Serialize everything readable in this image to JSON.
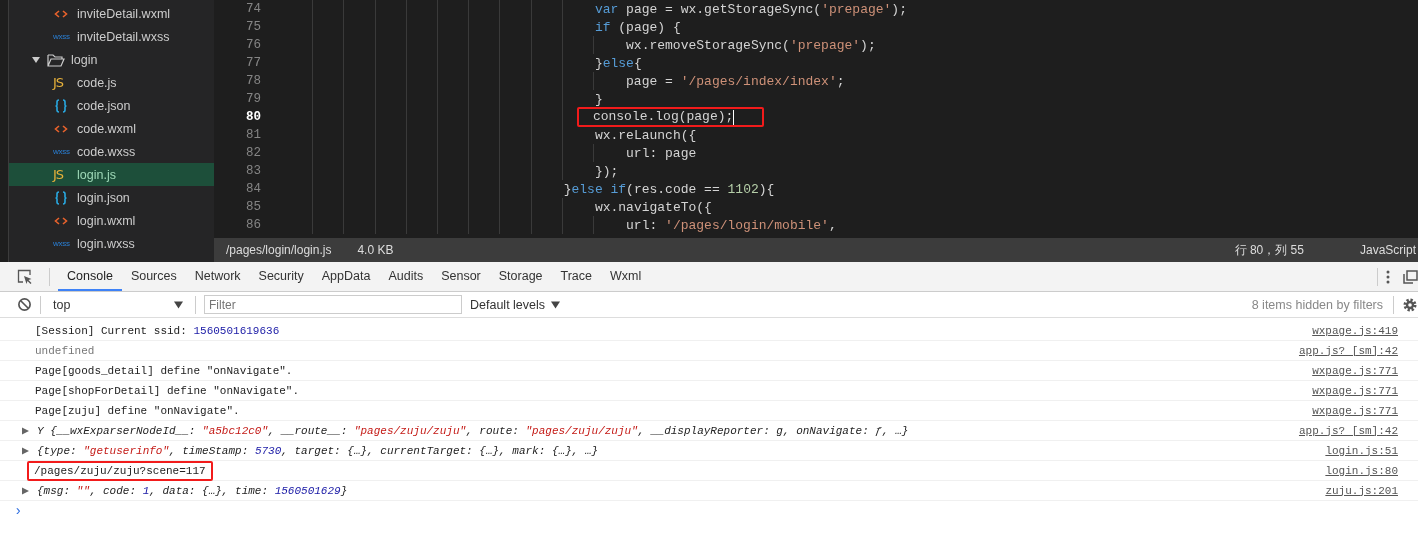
{
  "sidebar": {
    "items": [
      {
        "kind": "wxml",
        "label": "inviteDetail.wxml",
        "selected": false
      },
      {
        "kind": "wxss",
        "icon": "wxss",
        "label": "inviteDetail.wxss",
        "selected": false
      },
      {
        "kind": "folder",
        "label": "login",
        "selected": false,
        "expanded": true,
        "children": [
          {
            "kind": "js",
            "icon": "JS",
            "label": "code.js",
            "selected": false
          },
          {
            "kind": "json",
            "label": "code.json",
            "selected": false
          },
          {
            "kind": "wxml",
            "label": "code.wxml",
            "selected": false
          },
          {
            "kind": "wxss",
            "icon": "wxss",
            "label": "code.wxss",
            "selected": false
          },
          {
            "kind": "js",
            "icon": "JS",
            "label": "login.js",
            "selected": true
          },
          {
            "kind": "json",
            "label": "login.json",
            "selected": false
          },
          {
            "kind": "wxml",
            "label": "login.wxml",
            "selected": false
          },
          {
            "kind": "wxss",
            "icon": "wxss",
            "label": "login.wxss",
            "selected": false
          }
        ]
      }
    ]
  },
  "editor": {
    "lines": [
      {
        "number": "74",
        "current": false,
        "highlighted": false,
        "tokens": [
          {
            "kind": "keyword",
            "text": "                                        var"
          },
          {
            "kind": "plain",
            "text": " page = wx.getStorageSync("
          },
          {
            "kind": "string",
            "text": "'prepage'"
          },
          {
            "kind": "plain",
            "text": ");"
          }
        ]
      },
      {
        "number": "75",
        "current": false,
        "highlighted": false,
        "tokens": [
          {
            "kind": "keyword",
            "text": "                                        if"
          },
          {
            "kind": "plain",
            "text": " (page) {"
          }
        ]
      },
      {
        "number": "76",
        "current": false,
        "highlighted": false,
        "tokens": [
          {
            "kind": "plain",
            "text": "                                            wx.removeStorageSync("
          },
          {
            "kind": "string",
            "text": "'prepage'"
          },
          {
            "kind": "plain",
            "text": ");"
          }
        ]
      },
      {
        "number": "77",
        "current": false,
        "highlighted": false,
        "tokens": [
          {
            "kind": "plain",
            "text": "                                        }"
          },
          {
            "kind": "keyword",
            "text": "else"
          },
          {
            "kind": "plain",
            "text": "{"
          }
        ]
      },
      {
        "number": "78",
        "current": false,
        "highlighted": false,
        "tokens": [
          {
            "kind": "plain",
            "text": "                                            page = "
          },
          {
            "kind": "string",
            "text": "'/pages/index/index'"
          },
          {
            "kind": "plain",
            "text": ";"
          }
        ]
      },
      {
        "number": "79",
        "current": false,
        "highlighted": false,
        "tokens": [
          {
            "kind": "plain",
            "text": "                                        }"
          }
        ]
      },
      {
        "number": "80",
        "current": true,
        "highlighted": true,
        "tokens": [
          {
            "kind": "plain",
            "text": "                                        console.log(page);"
          }
        ]
      },
      {
        "number": "81",
        "current": false,
        "highlighted": false,
        "tokens": [
          {
            "kind": "plain",
            "text": "                                        wx.reLaunch({"
          }
        ]
      },
      {
        "number": "82",
        "current": false,
        "highlighted": false,
        "tokens": [
          {
            "kind": "plain",
            "text": "                                            url: page"
          }
        ]
      },
      {
        "number": "83",
        "current": false,
        "highlighted": false,
        "tokens": [
          {
            "kind": "plain",
            "text": "                                        });"
          }
        ]
      },
      {
        "number": "84",
        "current": false,
        "highlighted": false,
        "tokens": [
          {
            "kind": "plain",
            "text": "                                    }"
          },
          {
            "kind": "keyword",
            "text": "else if"
          },
          {
            "kind": "plain",
            "text": "(res.code == "
          },
          {
            "kind": "number",
            "text": "1102"
          },
          {
            "kind": "plain",
            "text": "){"
          }
        ]
      },
      {
        "number": "85",
        "current": false,
        "highlighted": false,
        "tokens": [
          {
            "kind": "plain",
            "text": "                                        wx.navigateTo({"
          }
        ]
      },
      {
        "number": "86",
        "current": false,
        "highlighted": false,
        "tokens": [
          {
            "kind": "plain",
            "text": "                                            url: "
          },
          {
            "kind": "string",
            "text": "'/pages/login/mobile'"
          },
          {
            "kind": "plain",
            "text": ","
          }
        ]
      }
    ]
  },
  "status_bar": {
    "path": "/pages/login/login.js",
    "size": "4.0 KB",
    "position": "行 80，列 55",
    "language": "JavaScript"
  },
  "devtools": {
    "tabs": [
      {
        "label": "Console",
        "selected": true
      },
      {
        "label": "Sources",
        "selected": false
      },
      {
        "label": "Network",
        "selected": false
      },
      {
        "label": "Security",
        "selected": false
      },
      {
        "label": "AppData",
        "selected": false
      },
      {
        "label": "Audits",
        "selected": false
      },
      {
        "label": "Sensor",
        "selected": false
      },
      {
        "label": "Storage",
        "selected": false
      },
      {
        "label": "Trace",
        "selected": false
      },
      {
        "label": "Wxml",
        "selected": false
      }
    ],
    "context": "top",
    "filter": {
      "placeholder": "Filter"
    },
    "levels": "Default levels",
    "hidden_count": "8 items hidden by filters",
    "messages": [
      {
        "kind": "text",
        "highlighted": false,
        "source": "wxpage.js:419",
        "tokens": [
          {
            "kind": "plain",
            "text": "[Session] Current ssid: "
          },
          {
            "kind": "number",
            "text": "1560501619636"
          }
        ]
      },
      {
        "kind": "text",
        "highlighted": false,
        "source": "app.js? [sm]:42",
        "tokens": [
          {
            "kind": "dim",
            "text": "undefined"
          }
        ]
      },
      {
        "kind": "text",
        "highlighted": false,
        "source": "wxpage.js:771",
        "tokens": [
          {
            "kind": "plain",
            "text": "Page[goods_detail] define \"onNavigate\"."
          }
        ]
      },
      {
        "kind": "text",
        "highlighted": false,
        "source": "wxpage.js:771",
        "tokens": [
          {
            "kind": "plain",
            "text": "Page[shopForDetail] define \"onNavigate\"."
          }
        ]
      },
      {
        "kind": "text",
        "highlighted": false,
        "source": "wxpage.js:771",
        "tokens": [
          {
            "kind": "plain",
            "text": "Page[zuju] define \"onNavigate\"."
          }
        ]
      },
      {
        "kind": "object",
        "expanded": false,
        "highlighted": false,
        "source": "app.js? [sm]:42",
        "tokens": [
          {
            "kind": "plain",
            "text": "Y {__wxExparserNodeId__: "
          },
          {
            "kind": "string",
            "text": "\"a5bc12c0\""
          },
          {
            "kind": "plain",
            "text": ", __route__: "
          },
          {
            "kind": "string",
            "text": "\"pages/zuju/zuju\""
          },
          {
            "kind": "plain",
            "text": ", route: "
          },
          {
            "kind": "string",
            "text": "\"pages/zuju/zuju\""
          },
          {
            "kind": "plain",
            "text": ", __displayReporter: g, onNavigate: ƒ, …}"
          }
        ]
      },
      {
        "kind": "object",
        "expanded": false,
        "highlighted": false,
        "source": "login.js:51",
        "tokens": [
          {
            "kind": "plain",
            "text": "{type: "
          },
          {
            "kind": "string",
            "text": "\"getuserinfo\""
          },
          {
            "kind": "plain",
            "text": ", timeStamp: "
          },
          {
            "kind": "number",
            "text": "5730"
          },
          {
            "kind": "plain",
            "text": ", target: {…}, currentTarget: {…}, mark: {…}, …}"
          }
        ]
      },
      {
        "kind": "text",
        "highlighted": true,
        "source": "login.js:80",
        "tokens": [
          {
            "kind": "plain",
            "text": "/pages/zuju/zuju?scene=117"
          }
        ]
      },
      {
        "kind": "object",
        "expanded": false,
        "highlighted": false,
        "source": "zuju.js:201",
        "tokens": [
          {
            "kind": "plain",
            "text": "{msg: "
          },
          {
            "kind": "string",
            "text": "\"\""
          },
          {
            "kind": "plain",
            "text": ", code: "
          },
          {
            "kind": "number",
            "text": "1"
          },
          {
            "kind": "plain",
            "text": ", data: {…}, time: "
          },
          {
            "kind": "number",
            "text": "1560501629"
          },
          {
            "kind": "plain",
            "text": "}"
          }
        ]
      }
    ],
    "prompt": "›"
  }
}
